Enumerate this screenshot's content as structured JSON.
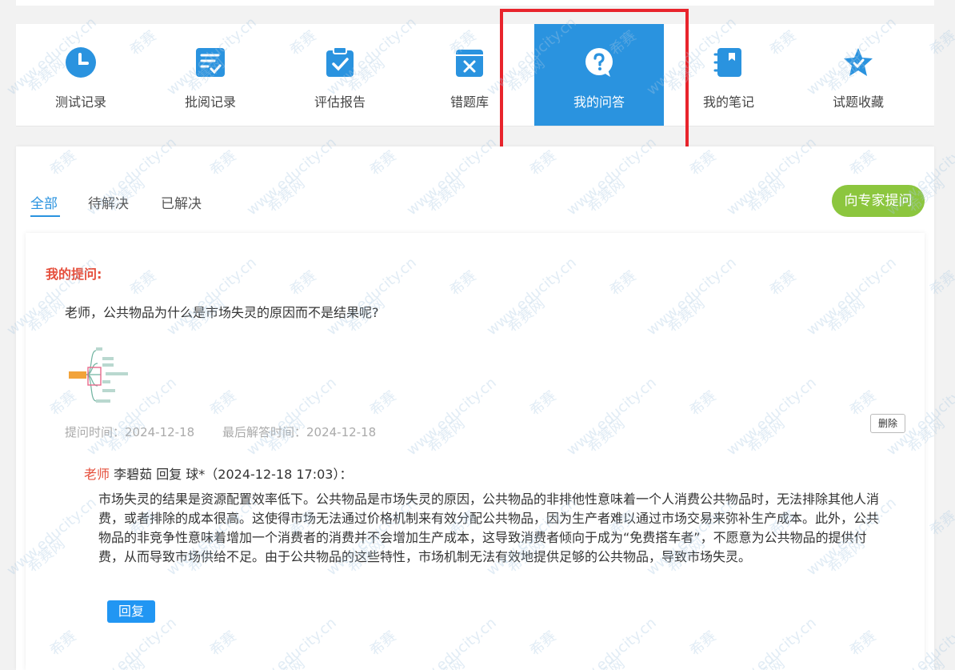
{
  "nav": {
    "items": [
      {
        "label": "测试记录",
        "icon": "clock-icon"
      },
      {
        "label": "批阅记录",
        "icon": "review-list-icon"
      },
      {
        "label": "评估报告",
        "icon": "clipboard-check-icon"
      },
      {
        "label": "错题库",
        "icon": "wrong-book-icon"
      },
      {
        "label": "我的问答",
        "icon": "question-bubble-icon",
        "active": true
      },
      {
        "label": "我的笔记",
        "icon": "notebook-icon"
      },
      {
        "label": "试题收藏",
        "icon": "star-icon"
      }
    ]
  },
  "tabs": {
    "all": "全部",
    "pending": "待解决",
    "solved": "已解决"
  },
  "ask_expert_label": "向专家提问",
  "question": {
    "label": "我的提问:",
    "text": "老师，公共物品为什么是市场失灵的原因而不是结果呢?",
    "ask_time": "提问时间：2024-12-18",
    "last_answer_time": "最后解答时间：2024-12-18",
    "delete_label": "删除"
  },
  "reply": {
    "teacher_tag": "老师",
    "author_line": "李碧茹 回复 球*（2024-12-18 17:03）：",
    "body": "市场失灵的结果是资源配置效率低下。公共物品是市场失灵的原因，公共物品的非排他性意味着一个人消费公共物品时，无法排除其他人消费，或者排除的成本很高。这使得市场无法通过价格机制来有效分配公共物品，因为生产者难以通过市场交易来弥补生产成本。此外，公共物品的非竞争性意味着增加一个消费者的消费并不会增加生产成本，这导致消费者倾向于成为“免费搭车者”，不愿意为公共物品的提供付费，从而导致市场供给不足。由于公共物品的这些特性，市场机制无法有效地提供足够的公共物品，导致市场失灵。",
    "reply_label": "回复"
  },
  "watermark": {
    "brand": "希赛",
    "site": "www.educity.cn",
    "net": "希赛网"
  },
  "colors": {
    "accent_blue": "#2a93df",
    "green_button": "#8cc63e",
    "red_label": "#e54e3b",
    "highlight_red": "#e8242c"
  }
}
